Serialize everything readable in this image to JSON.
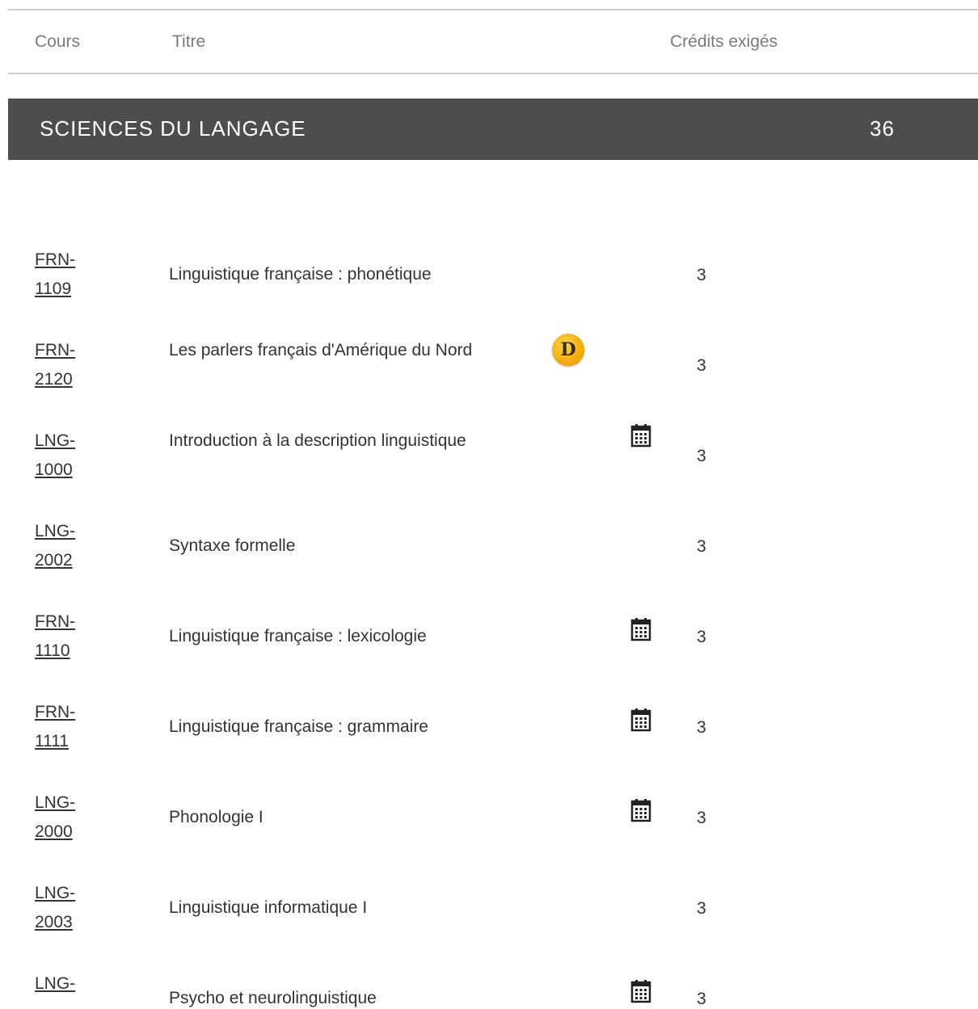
{
  "table_header": {
    "cours": "Cours",
    "titre": "Titre",
    "credits": "Crédits exigés"
  },
  "section": {
    "title": "SCIENCES DU LANGAGE",
    "credits": "36"
  },
  "courses": [
    {
      "code_prefix": "FRN-",
      "code_number": "1109",
      "title": "Linguistique française : phonétique",
      "credits": "3",
      "icon": ""
    },
    {
      "code_prefix": "FRN-",
      "code_number": "2120",
      "title": "Les parlers français d'Amérique du Nord",
      "credits": "3",
      "icon": "distance-d-badge-icon"
    },
    {
      "code_prefix": "LNG-",
      "code_number": "1000",
      "title": "Introduction à la description linguistique",
      "credits": "3",
      "icon": "calendar-icon"
    },
    {
      "code_prefix": "LNG-",
      "code_number": "2002",
      "title": "Syntaxe formelle",
      "credits": "3",
      "icon": ""
    },
    {
      "code_prefix": "FRN-",
      "code_number": "1110",
      "title": "Linguistique française : lexicologie",
      "credits": "3",
      "icon": "calendar-icon"
    },
    {
      "code_prefix": "FRN-",
      "code_number": "1111",
      "title": "Linguistique française : grammaire",
      "credits": "3",
      "icon": "calendar-icon"
    },
    {
      "code_prefix": "LNG-",
      "code_number": "2000",
      "title": "Phonologie I",
      "credits": "3",
      "icon": "calendar-icon"
    },
    {
      "code_prefix": "LNG-",
      "code_number": "2003",
      "title": "Linguistique informatique I",
      "credits": "3",
      "icon": ""
    },
    {
      "code_prefix": "LNG-",
      "code_number": "",
      "title": "Psycho et neurolinguistique",
      "credits": "3",
      "icon": "calendar-icon"
    }
  ],
  "badge_letter": "D",
  "colors": {
    "section_bar": "#4d4d4d",
    "badge": "#f0a500",
    "divider": "#cfcfcf"
  }
}
